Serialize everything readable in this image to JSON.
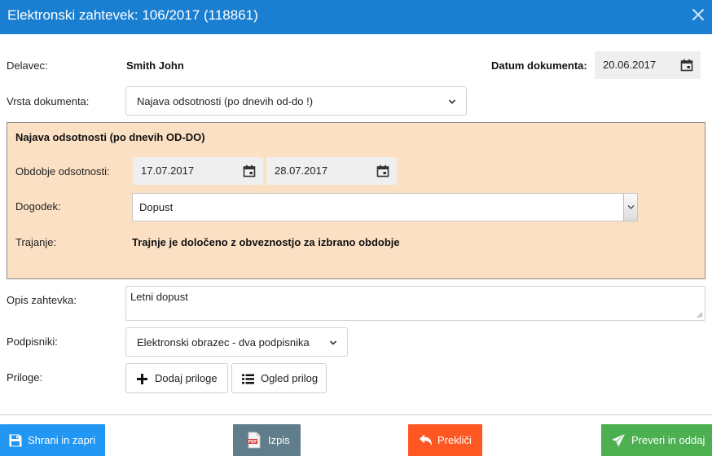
{
  "dialog": {
    "title": "Elektronski zahtevek: 106/2017 (118861)"
  },
  "form": {
    "employee_label": "Delavec:",
    "employee_value": "Smith John",
    "doc_date_label": "Datum dokumenta:",
    "doc_date_value": "20.06.2017",
    "doc_type_label": "Vrsta dokumenta:",
    "doc_type_value": "Najava odsotnosti (po dnevih od-do !)",
    "description_label": "Opis zahtevka:",
    "description_value": "Letni dopust",
    "signers_label": "Podpisniki:",
    "signers_value": "Elektronski obrazec - dva podpisnika",
    "attachments_label": "Priloge:",
    "add_attachment_label": "Dodaj priloge",
    "view_attachments_label": "Ogled prilog"
  },
  "absence_panel": {
    "heading": "Najava odsotnosti (po dnevih OD-DO)",
    "period_label": "Obdobje odsotnosti:",
    "date_from": "17.07.2017",
    "date_to": "28.07.2017",
    "event_label": "Dogodek:",
    "event_value": "Dopust",
    "duration_label": "Trajanje:",
    "duration_value": "Trajnje je določeno z obveznostjo za izbrano obdobje"
  },
  "actions": {
    "save_close": "Shrani in zapri",
    "print": "Izpis",
    "cancel": "Prekliči",
    "verify_send": "Preveri in oddaj"
  },
  "colors": {
    "titlebar": "#1a7fd1",
    "panel_bg": "#fce0c4",
    "save_btn": "#2196f3",
    "print_btn": "#607d8b",
    "cancel_btn": "#ff5722",
    "send_btn": "#4caf50"
  },
  "icons": {
    "close": "close-icon",
    "calendar": "calendar-icon",
    "chevron": "chevron-down-icon",
    "plus": "plus-icon",
    "list": "list-icon",
    "save": "floppy-disk-icon",
    "pdf": "pdf-file-icon",
    "undo": "undo-arrow-icon",
    "send": "paper-plane-icon"
  }
}
